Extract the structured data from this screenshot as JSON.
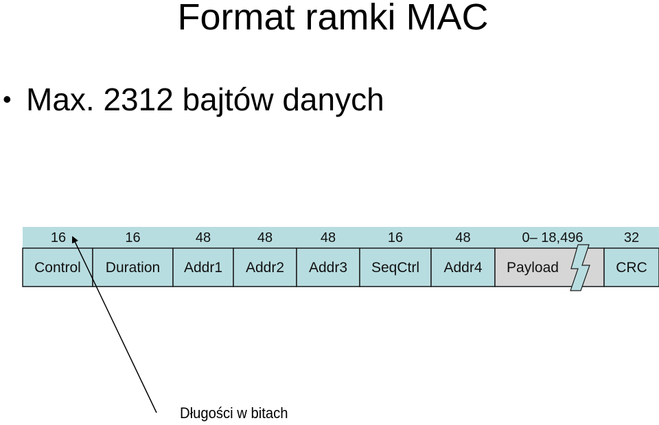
{
  "slide": {
    "title": "Format ramki MAC",
    "bullets": [
      "Max. 2312 bajtów danych"
    ],
    "caption": "Długości w bitach"
  },
  "frame": {
    "fields": [
      {
        "name": "Control",
        "bits": "16"
      },
      {
        "name": "Duration",
        "bits": "16"
      },
      {
        "name": "Addr1",
        "bits": "48"
      },
      {
        "name": "Addr2",
        "bits": "48"
      },
      {
        "name": "Addr3",
        "bits": "48"
      },
      {
        "name": "SeqCtrl",
        "bits": "16"
      },
      {
        "name": "Addr4",
        "bits": "48"
      },
      {
        "name": "Payload",
        "bits": "0– 18,496",
        "variable": true
      },
      {
        "name": "CRC",
        "bits": "32"
      }
    ],
    "colors": {
      "field_fill": "#b8dde0",
      "payload_fill": "#d6d6d6",
      "border": "#1a1a1a"
    }
  }
}
